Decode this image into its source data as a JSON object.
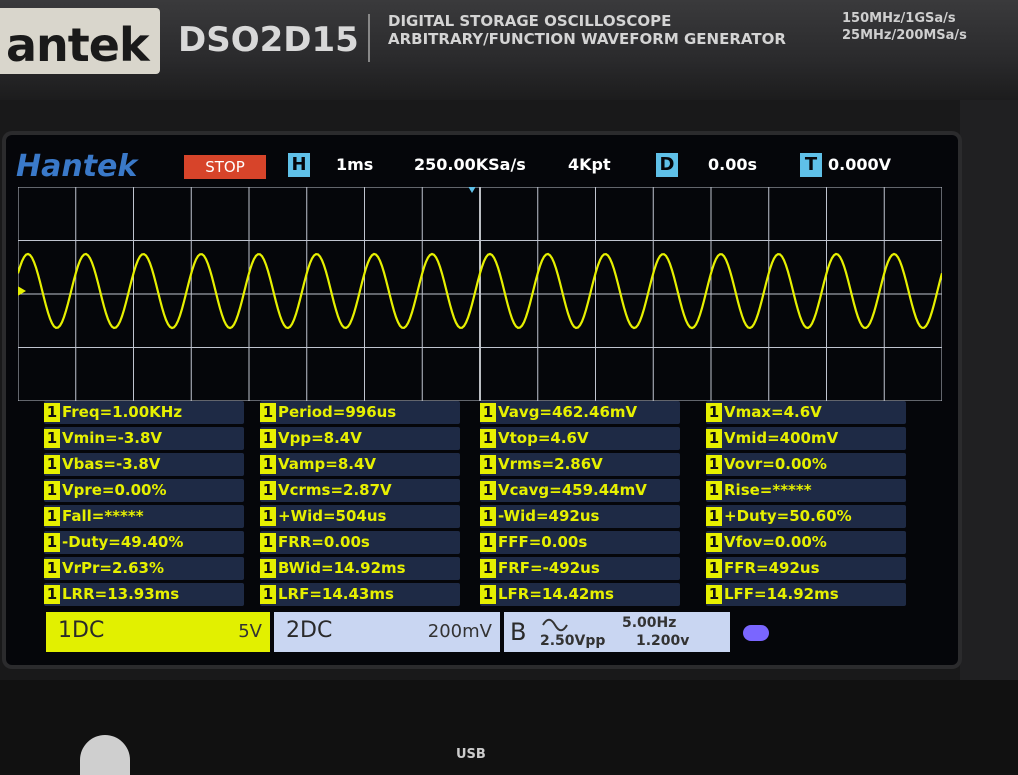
{
  "device": {
    "brand": "antek",
    "model": "DSO2D15",
    "description_line1": "DIGITAL STORAGE OSCILLOSCOPE",
    "description_line2": "ARBITRARY/FUNCTION WAVEFORM GENERATOR",
    "spec_line1": "150MHz/1GSa/s",
    "spec_line2": "25MHz/200MSa/s",
    "usb_label": "USB"
  },
  "screen": {
    "logo": "Hantek",
    "run_state": "STOP",
    "h_badge": "H",
    "timebase": "1ms",
    "sample_rate": "250.00KSa/s",
    "memory_depth": "4Kpt",
    "d_badge": "D",
    "delay": "0.00s",
    "t_badge": "T",
    "trigger_level": "0.000V",
    "colors": {
      "trace": "#e6f000",
      "grid": "#cfd3dc",
      "stop": "#d7442a",
      "badge": "#5fc0e8"
    }
  },
  "measurements": [
    [
      "1",
      "Freq=1.00KHz"
    ],
    [
      "1",
      "Period=996us"
    ],
    [
      "1",
      "Vavg=462.46mV"
    ],
    [
      "1",
      "Vmax=4.6V"
    ],
    [
      "1",
      "Vmin=-3.8V"
    ],
    [
      "1",
      "Vpp=8.4V"
    ],
    [
      "1",
      "Vtop=4.6V"
    ],
    [
      "1",
      "Vmid=400mV"
    ],
    [
      "1",
      "Vbas=-3.8V"
    ],
    [
      "1",
      "Vamp=8.4V"
    ],
    [
      "1",
      "Vrms=2.86V"
    ],
    [
      "1",
      "Vovr=0.00%"
    ],
    [
      "1",
      "Vpre=0.00%"
    ],
    [
      "1",
      "Vcrms=2.87V"
    ],
    [
      "1",
      "Vcavg=459.44mV"
    ],
    [
      "1",
      "Rise=*****"
    ],
    [
      "1",
      "Fall=*****"
    ],
    [
      "1",
      "+Wid=504us"
    ],
    [
      "1",
      "-Wid=492us"
    ],
    [
      "1",
      "+Duty=50.60%"
    ],
    [
      "1",
      "-Duty=49.40%"
    ],
    [
      "1",
      "FRR=0.00s"
    ],
    [
      "1",
      "FFF=0.00s"
    ],
    [
      "1",
      "Vfov=0.00%"
    ],
    [
      "1",
      "VrPr=2.63%"
    ],
    [
      "1",
      "BWid=14.92ms"
    ],
    [
      "1",
      "FRF=-492us"
    ],
    [
      "1",
      "FFR=492us"
    ],
    [
      "1",
      "LRR=13.93ms"
    ],
    [
      "1",
      "LRF=14.43ms"
    ],
    [
      "1",
      "LFR=14.42ms"
    ],
    [
      "1",
      "LFF=14.92ms"
    ]
  ],
  "channels": {
    "ch1": {
      "label": "1DC",
      "scale": "5V"
    },
    "ch2": {
      "label": "2DC",
      "scale": "200mV"
    },
    "gen": {
      "label": "B",
      "freq": "5.00Hz",
      "amp": "2.50Vpp",
      "offset": "1.200v"
    }
  }
}
